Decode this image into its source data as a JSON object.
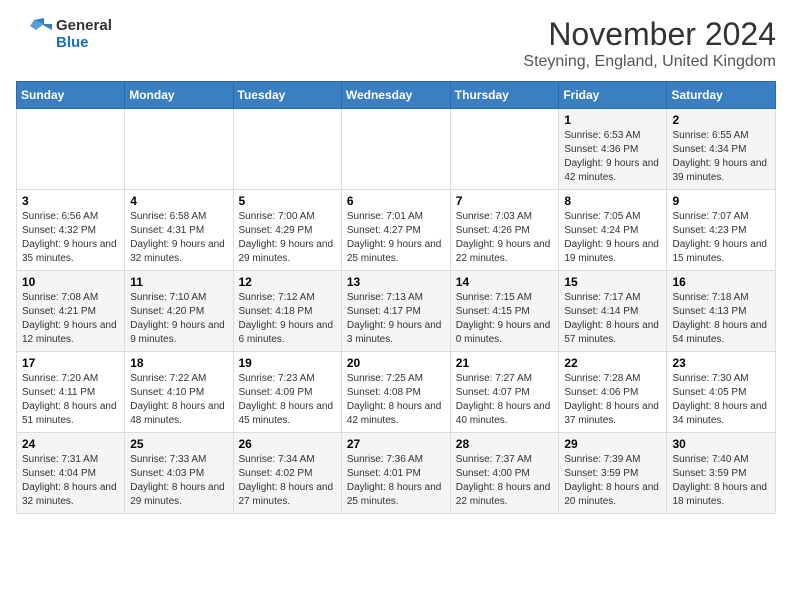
{
  "header": {
    "logo_general": "General",
    "logo_blue": "Blue",
    "title": "November 2024",
    "subtitle": "Steyning, England, United Kingdom"
  },
  "days_of_week": [
    "Sunday",
    "Monday",
    "Tuesday",
    "Wednesday",
    "Thursday",
    "Friday",
    "Saturday"
  ],
  "weeks": [
    {
      "days": [
        {
          "num": "",
          "info": ""
        },
        {
          "num": "",
          "info": ""
        },
        {
          "num": "",
          "info": ""
        },
        {
          "num": "",
          "info": ""
        },
        {
          "num": "",
          "info": ""
        },
        {
          "num": "1",
          "info": "Sunrise: 6:53 AM\nSunset: 4:36 PM\nDaylight: 9 hours and 42 minutes."
        },
        {
          "num": "2",
          "info": "Sunrise: 6:55 AM\nSunset: 4:34 PM\nDaylight: 9 hours and 39 minutes."
        }
      ]
    },
    {
      "days": [
        {
          "num": "3",
          "info": "Sunrise: 6:56 AM\nSunset: 4:32 PM\nDaylight: 9 hours and 35 minutes."
        },
        {
          "num": "4",
          "info": "Sunrise: 6:58 AM\nSunset: 4:31 PM\nDaylight: 9 hours and 32 minutes."
        },
        {
          "num": "5",
          "info": "Sunrise: 7:00 AM\nSunset: 4:29 PM\nDaylight: 9 hours and 29 minutes."
        },
        {
          "num": "6",
          "info": "Sunrise: 7:01 AM\nSunset: 4:27 PM\nDaylight: 9 hours and 25 minutes."
        },
        {
          "num": "7",
          "info": "Sunrise: 7:03 AM\nSunset: 4:26 PM\nDaylight: 9 hours and 22 minutes."
        },
        {
          "num": "8",
          "info": "Sunrise: 7:05 AM\nSunset: 4:24 PM\nDaylight: 9 hours and 19 minutes."
        },
        {
          "num": "9",
          "info": "Sunrise: 7:07 AM\nSunset: 4:23 PM\nDaylight: 9 hours and 15 minutes."
        }
      ]
    },
    {
      "days": [
        {
          "num": "10",
          "info": "Sunrise: 7:08 AM\nSunset: 4:21 PM\nDaylight: 9 hours and 12 minutes."
        },
        {
          "num": "11",
          "info": "Sunrise: 7:10 AM\nSunset: 4:20 PM\nDaylight: 9 hours and 9 minutes."
        },
        {
          "num": "12",
          "info": "Sunrise: 7:12 AM\nSunset: 4:18 PM\nDaylight: 9 hours and 6 minutes."
        },
        {
          "num": "13",
          "info": "Sunrise: 7:13 AM\nSunset: 4:17 PM\nDaylight: 9 hours and 3 minutes."
        },
        {
          "num": "14",
          "info": "Sunrise: 7:15 AM\nSunset: 4:15 PM\nDaylight: 9 hours and 0 minutes."
        },
        {
          "num": "15",
          "info": "Sunrise: 7:17 AM\nSunset: 4:14 PM\nDaylight: 8 hours and 57 minutes."
        },
        {
          "num": "16",
          "info": "Sunrise: 7:18 AM\nSunset: 4:13 PM\nDaylight: 8 hours and 54 minutes."
        }
      ]
    },
    {
      "days": [
        {
          "num": "17",
          "info": "Sunrise: 7:20 AM\nSunset: 4:11 PM\nDaylight: 8 hours and 51 minutes."
        },
        {
          "num": "18",
          "info": "Sunrise: 7:22 AM\nSunset: 4:10 PM\nDaylight: 8 hours and 48 minutes."
        },
        {
          "num": "19",
          "info": "Sunrise: 7:23 AM\nSunset: 4:09 PM\nDaylight: 8 hours and 45 minutes."
        },
        {
          "num": "20",
          "info": "Sunrise: 7:25 AM\nSunset: 4:08 PM\nDaylight: 8 hours and 42 minutes."
        },
        {
          "num": "21",
          "info": "Sunrise: 7:27 AM\nSunset: 4:07 PM\nDaylight: 8 hours and 40 minutes."
        },
        {
          "num": "22",
          "info": "Sunrise: 7:28 AM\nSunset: 4:06 PM\nDaylight: 8 hours and 37 minutes."
        },
        {
          "num": "23",
          "info": "Sunrise: 7:30 AM\nSunset: 4:05 PM\nDaylight: 8 hours and 34 minutes."
        }
      ]
    },
    {
      "days": [
        {
          "num": "24",
          "info": "Sunrise: 7:31 AM\nSunset: 4:04 PM\nDaylight: 8 hours and 32 minutes."
        },
        {
          "num": "25",
          "info": "Sunrise: 7:33 AM\nSunset: 4:03 PM\nDaylight: 8 hours and 29 minutes."
        },
        {
          "num": "26",
          "info": "Sunrise: 7:34 AM\nSunset: 4:02 PM\nDaylight: 8 hours and 27 minutes."
        },
        {
          "num": "27",
          "info": "Sunrise: 7:36 AM\nSunset: 4:01 PM\nDaylight: 8 hours and 25 minutes."
        },
        {
          "num": "28",
          "info": "Sunrise: 7:37 AM\nSunset: 4:00 PM\nDaylight: 8 hours and 22 minutes."
        },
        {
          "num": "29",
          "info": "Sunrise: 7:39 AM\nSunset: 3:59 PM\nDaylight: 8 hours and 20 minutes."
        },
        {
          "num": "30",
          "info": "Sunrise: 7:40 AM\nSunset: 3:59 PM\nDaylight: 8 hours and 18 minutes."
        }
      ]
    }
  ]
}
